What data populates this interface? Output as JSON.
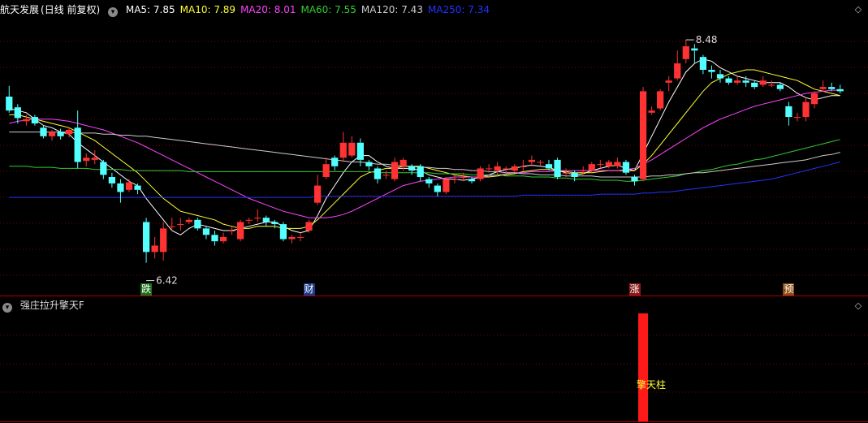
{
  "main_panel": {
    "stock_name": "航天发展",
    "period": "(日线 前复权)",
    "ma_legend": [
      {
        "label": "MA5: 7.85",
        "color": "#ffffff"
      },
      {
        "label": "MA10: 7.89",
        "color": "#ffff33"
      },
      {
        "label": "MA20: 8.01",
        "color": "#ff44ff"
      },
      {
        "label": "MA60: 7.55",
        "color": "#33cc33"
      },
      {
        "label": "MA120: 7.43",
        "color": "#cccccc"
      },
      {
        "label": "MA250: 7.34",
        "color": "#2233ff"
      }
    ],
    "high_marker": "8.48",
    "low_marker": "6.42",
    "signal_tags": [
      {
        "text": "跌",
        "bg": "#1a6e1a",
        "color": "#ffffff"
      },
      {
        "text": "财",
        "bg": "#1a3a8a",
        "color": "#ffffff"
      },
      {
        "text": "涨",
        "bg": "#8a1a1a",
        "color": "#ffffff"
      },
      {
        "text": "预",
        "bg": "#8a4a10",
        "color": "#ffffff"
      }
    ]
  },
  "sub_panel": {
    "indicator_name": "强庄拉升擎天F",
    "pillar_label": "擎天柱"
  },
  "icons": {
    "settings": "circle-down-icon",
    "maximize": "diamond-icon"
  },
  "colors": {
    "up": "#ff3333",
    "down": "#54ffff",
    "grid": "#7a0000",
    "pillar": "#ff1a1a"
  },
  "chart_data": {
    "type": "candlestick",
    "y_range": [
      6.2,
      8.7
    ],
    "candles": [
      {
        "o": 7.95,
        "c": 7.82,
        "h": 8.05,
        "l": 7.8
      },
      {
        "o": 7.85,
        "c": 7.75,
        "h": 7.88,
        "l": 7.7
      },
      {
        "o": 7.72,
        "c": 7.74,
        "h": 7.78,
        "l": 7.68
      },
      {
        "o": 7.76,
        "c": 7.7,
        "h": 7.78,
        "l": 7.68
      },
      {
        "o": 7.66,
        "c": 7.58,
        "h": 7.68,
        "l": 7.56
      },
      {
        "o": 7.58,
        "c": 7.62,
        "h": 7.64,
        "l": 7.54
      },
      {
        "o": 7.62,
        "c": 7.58,
        "h": 7.65,
        "l": 7.55
      },
      {
        "o": 7.6,
        "c": 7.64,
        "h": 7.66,
        "l": 7.57
      },
      {
        "o": 7.66,
        "c": 7.34,
        "h": 7.82,
        "l": 7.28
      },
      {
        "o": 7.35,
        "c": 7.38,
        "h": 7.42,
        "l": 7.3
      },
      {
        "o": 7.36,
        "c": 7.38,
        "h": 7.45,
        "l": 7.32
      },
      {
        "o": 7.34,
        "c": 7.22,
        "h": 7.36,
        "l": 7.18
      },
      {
        "o": 7.2,
        "c": 7.14,
        "h": 7.24,
        "l": 7.1
      },
      {
        "o": 7.14,
        "c": 7.06,
        "h": 7.18,
        "l": 6.96
      },
      {
        "o": 7.08,
        "c": 7.15,
        "h": 7.18,
        "l": 7.06
      },
      {
        "o": 7.12,
        "c": 7.08,
        "h": 7.14,
        "l": 7.04
      },
      {
        "o": 6.78,
        "c": 6.5,
        "h": 6.82,
        "l": 6.4
      },
      {
        "o": 6.5,
        "c": 6.56,
        "h": 6.64,
        "l": 6.44
      },
      {
        "o": 6.5,
        "c": 6.72,
        "h": 6.78,
        "l": 6.42
      },
      {
        "o": 6.74,
        "c": 6.74,
        "h": 6.82,
        "l": 6.7
      },
      {
        "o": 6.76,
        "c": 6.76,
        "h": 6.82,
        "l": 6.7
      },
      {
        "o": 6.78,
        "c": 6.8,
        "h": 6.82,
        "l": 6.76
      },
      {
        "o": 6.8,
        "c": 6.72,
        "h": 6.82,
        "l": 6.7
      },
      {
        "o": 6.72,
        "c": 6.66,
        "h": 6.74,
        "l": 6.62
      },
      {
        "o": 6.66,
        "c": 6.6,
        "h": 6.7,
        "l": 6.56
      },
      {
        "o": 6.6,
        "c": 6.64,
        "h": 6.68,
        "l": 6.58
      },
      {
        "o": 6.7,
        "c": 6.7,
        "h": 6.74,
        "l": 6.66
      },
      {
        "o": 6.62,
        "c": 6.78,
        "h": 6.8,
        "l": 6.6
      },
      {
        "o": 6.8,
        "c": 6.8,
        "h": 6.82,
        "l": 6.76
      },
      {
        "o": 6.82,
        "c": 6.82,
        "h": 6.9,
        "l": 6.78
      },
      {
        "o": 6.82,
        "c": 6.78,
        "h": 6.84,
        "l": 6.74
      },
      {
        "o": 6.78,
        "c": 6.76,
        "h": 6.8,
        "l": 6.72
      },
      {
        "o": 6.76,
        "c": 6.62,
        "h": 6.78,
        "l": 6.6
      },
      {
        "o": 6.62,
        "c": 6.64,
        "h": 6.66,
        "l": 6.58
      },
      {
        "o": 6.64,
        "c": 6.64,
        "h": 6.68,
        "l": 6.6
      },
      {
        "o": 6.7,
        "c": 6.78,
        "h": 6.8,
        "l": 6.68
      },
      {
        "o": 6.96,
        "c": 7.12,
        "h": 7.22,
        "l": 6.94
      },
      {
        "o": 7.2,
        "c": 7.32,
        "h": 7.38,
        "l": 7.18
      },
      {
        "o": 7.38,
        "c": 7.3,
        "h": 7.4,
        "l": 7.26
      },
      {
        "o": 7.38,
        "c": 7.52,
        "h": 7.62,
        "l": 7.34
      },
      {
        "o": 7.4,
        "c": 7.52,
        "h": 7.58,
        "l": 7.38
      },
      {
        "o": 7.52,
        "c": 7.36,
        "h": 7.56,
        "l": 7.3
      },
      {
        "o": 7.34,
        "c": 7.3,
        "h": 7.36,
        "l": 7.26
      },
      {
        "o": 7.28,
        "c": 7.18,
        "h": 7.3,
        "l": 7.14
      },
      {
        "o": 7.22,
        "c": 7.22,
        "h": 7.26,
        "l": 7.18
      },
      {
        "o": 7.18,
        "c": 7.34,
        "h": 7.38,
        "l": 7.16
      },
      {
        "o": 7.3,
        "c": 7.36,
        "h": 7.38,
        "l": 7.26
      },
      {
        "o": 7.3,
        "c": 7.26,
        "h": 7.32,
        "l": 7.22
      },
      {
        "o": 7.3,
        "c": 7.2,
        "h": 7.32,
        "l": 7.16
      },
      {
        "o": 7.18,
        "c": 7.14,
        "h": 7.2,
        "l": 7.1
      },
      {
        "o": 7.12,
        "c": 7.06,
        "h": 7.14,
        "l": 7.02
      },
      {
        "o": 7.06,
        "c": 7.18,
        "h": 7.2,
        "l": 7.04
      },
      {
        "o": 7.18,
        "c": 7.18,
        "h": 7.22,
        "l": 7.14
      },
      {
        "o": 7.2,
        "c": 7.2,
        "h": 7.24,
        "l": 7.16
      },
      {
        "o": 7.18,
        "c": 7.16,
        "h": 7.2,
        "l": 7.14
      },
      {
        "o": 7.18,
        "c": 7.28,
        "h": 7.3,
        "l": 7.16
      },
      {
        "o": 7.28,
        "c": 7.28,
        "h": 7.32,
        "l": 7.24
      },
      {
        "o": 7.26,
        "c": 7.3,
        "h": 7.34,
        "l": 7.22
      },
      {
        "o": 7.28,
        "c": 7.28,
        "h": 7.3,
        "l": 7.24
      },
      {
        "o": 7.26,
        "c": 7.3,
        "h": 7.32,
        "l": 7.24
      },
      {
        "o": 7.3,
        "c": 7.3,
        "h": 7.36,
        "l": 7.26
      },
      {
        "o": 7.34,
        "c": 7.36,
        "h": 7.4,
        "l": 7.3
      },
      {
        "o": 7.34,
        "c": 7.34,
        "h": 7.36,
        "l": 7.3
      },
      {
        "o": 7.32,
        "c": 7.28,
        "h": 7.36,
        "l": 7.26
      },
      {
        "o": 7.36,
        "c": 7.2,
        "h": 7.38,
        "l": 7.18
      },
      {
        "o": 7.24,
        "c": 7.24,
        "h": 7.28,
        "l": 7.2
      },
      {
        "o": 7.24,
        "c": 7.2,
        "h": 7.26,
        "l": 7.16
      },
      {
        "o": 7.26,
        "c": 7.26,
        "h": 7.3,
        "l": 7.22
      },
      {
        "o": 7.26,
        "c": 7.32,
        "h": 7.34,
        "l": 7.24
      },
      {
        "o": 7.32,
        "c": 7.32,
        "h": 7.36,
        "l": 7.28
      },
      {
        "o": 7.3,
        "c": 7.34,
        "h": 7.36,
        "l": 7.28
      },
      {
        "o": 7.3,
        "c": 7.34,
        "h": 7.38,
        "l": 7.28
      },
      {
        "o": 7.34,
        "c": 7.24,
        "h": 7.36,
        "l": 7.22
      },
      {
        "o": 7.2,
        "c": 7.16,
        "h": 7.22,
        "l": 7.12
      },
      {
        "o": 7.18,
        "c": 8.0,
        "h": 8.04,
        "l": 7.16
      },
      {
        "o": 7.8,
        "c": 7.82,
        "h": 7.86,
        "l": 7.78
      },
      {
        "o": 7.84,
        "c": 8.0,
        "h": 8.02,
        "l": 7.82
      },
      {
        "o": 8.08,
        "c": 8.1,
        "h": 8.14,
        "l": 8.0
      },
      {
        "o": 8.12,
        "c": 8.26,
        "h": 8.38,
        "l": 8.1
      },
      {
        "o": 8.3,
        "c": 8.42,
        "h": 8.48,
        "l": 8.26
      },
      {
        "o": 8.4,
        "c": 8.38,
        "h": 8.44,
        "l": 8.26
      },
      {
        "o": 8.32,
        "c": 8.2,
        "h": 8.34,
        "l": 8.16
      },
      {
        "o": 8.2,
        "c": 8.18,
        "h": 8.24,
        "l": 8.12
      },
      {
        "o": 8.16,
        "c": 8.12,
        "h": 8.2,
        "l": 8.08
      },
      {
        "o": 8.12,
        "c": 8.08,
        "h": 8.14,
        "l": 8.06
      },
      {
        "o": 8.08,
        "c": 8.1,
        "h": 8.14,
        "l": 8.06
      },
      {
        "o": 8.1,
        "c": 8.08,
        "h": 8.14,
        "l": 8.04
      },
      {
        "o": 8.08,
        "c": 8.04,
        "h": 8.1,
        "l": 8.02
      },
      {
        "o": 8.06,
        "c": 8.1,
        "h": 8.14,
        "l": 8.04
      },
      {
        "o": 8.06,
        "c": 8.06,
        "h": 8.1,
        "l": 8.04
      },
      {
        "o": 8.06,
        "c": 8.02,
        "h": 8.08,
        "l": 8.0
      },
      {
        "o": 7.86,
        "c": 7.76,
        "h": 7.9,
        "l": 7.68
      },
      {
        "o": 7.76,
        "c": 7.76,
        "h": 7.8,
        "l": 7.72
      },
      {
        "o": 7.76,
        "c": 7.9,
        "h": 7.94,
        "l": 7.72
      },
      {
        "o": 7.88,
        "c": 7.98,
        "h": 8.0,
        "l": 7.84
      },
      {
        "o": 8.02,
        "c": 8.04,
        "h": 8.1,
        "l": 8.0
      },
      {
        "o": 8.04,
        "c": 8.02,
        "h": 8.08,
        "l": 8.0
      },
      {
        "o": 8.02,
        "c": 8.0,
        "h": 8.06,
        "l": 7.98
      }
    ],
    "ma_lines": {
      "MA5": [
        7.84,
        7.82,
        7.8,
        7.74,
        7.68,
        7.66,
        7.62,
        7.6,
        7.52,
        7.46,
        7.4,
        7.34,
        7.28,
        7.22,
        7.16,
        7.12,
        7.0,
        6.9,
        6.8,
        6.7,
        6.66,
        6.72,
        6.76,
        6.74,
        6.72,
        6.7,
        6.7,
        6.72,
        6.74,
        6.76,
        6.78,
        6.78,
        6.74,
        6.7,
        6.68,
        6.7,
        6.84,
        7.0,
        7.12,
        7.24,
        7.34,
        7.4,
        7.4,
        7.34,
        7.3,
        7.28,
        7.28,
        7.28,
        7.26,
        7.22,
        7.2,
        7.18,
        7.18,
        7.17,
        7.18,
        7.2,
        7.22,
        7.25,
        7.27,
        7.28,
        7.3,
        7.31,
        7.3,
        7.29,
        7.26,
        7.24,
        7.22,
        7.23,
        7.26,
        7.28,
        7.3,
        7.31,
        7.28,
        7.26,
        7.42,
        7.58,
        7.74,
        7.9,
        8.04,
        8.18,
        8.26,
        8.3,
        8.28,
        8.22,
        8.18,
        8.14,
        8.12,
        8.1,
        8.08,
        8.08,
        8.08,
        8.04,
        7.98,
        7.94,
        7.92,
        7.94,
        7.96,
        7.96
      ],
      "MA10": [
        7.78,
        7.78,
        7.76,
        7.74,
        7.72,
        7.7,
        7.68,
        7.66,
        7.62,
        7.58,
        7.54,
        7.48,
        7.42,
        7.36,
        7.3,
        7.24,
        7.16,
        7.08,
        7.0,
        6.94,
        6.88,
        6.86,
        6.84,
        6.82,
        6.8,
        6.76,
        6.74,
        6.72,
        6.72,
        6.74,
        6.74,
        6.74,
        6.72,
        6.72,
        6.72,
        6.74,
        6.8,
        6.88,
        6.96,
        7.04,
        7.12,
        7.2,
        7.24,
        7.26,
        7.28,
        7.28,
        7.3,
        7.3,
        7.3,
        7.28,
        7.26,
        7.24,
        7.22,
        7.21,
        7.2,
        7.2,
        7.2,
        7.21,
        7.22,
        7.23,
        7.25,
        7.26,
        7.27,
        7.27,
        7.26,
        7.25,
        7.24,
        7.24,
        7.24,
        7.25,
        7.26,
        7.26,
        7.26,
        7.26,
        7.32,
        7.4,
        7.5,
        7.6,
        7.7,
        7.8,
        7.9,
        8.0,
        8.08,
        8.12,
        8.16,
        8.18,
        8.2,
        8.2,
        8.18,
        8.16,
        8.14,
        8.12,
        8.1,
        8.06,
        8.02,
        8.0,
        7.98,
        7.96
      ],
      "MA20": [
        7.7,
        7.72,
        7.73,
        7.74,
        7.74,
        7.74,
        7.73,
        7.72,
        7.7,
        7.68,
        7.66,
        7.64,
        7.61,
        7.58,
        7.55,
        7.52,
        7.48,
        7.44,
        7.4,
        7.36,
        7.32,
        7.28,
        7.24,
        7.2,
        7.16,
        7.12,
        7.08,
        7.04,
        7.0,
        6.97,
        6.94,
        6.91,
        6.88,
        6.86,
        6.84,
        6.82,
        6.82,
        6.82,
        6.83,
        6.85,
        6.88,
        6.92,
        6.96,
        7.0,
        7.04,
        7.08,
        7.12,
        7.14,
        7.16,
        7.17,
        7.18,
        7.19,
        7.2,
        7.2,
        7.2,
        7.2,
        7.21,
        7.22,
        7.23,
        7.24,
        7.24,
        7.25,
        7.25,
        7.25,
        7.26,
        7.26,
        7.26,
        7.26,
        7.26,
        7.26,
        7.26,
        7.26,
        7.27,
        7.28,
        7.32,
        7.36,
        7.41,
        7.46,
        7.51,
        7.56,
        7.61,
        7.66,
        7.7,
        7.74,
        7.77,
        7.8,
        7.83,
        7.86,
        7.88,
        7.9,
        7.92,
        7.94,
        7.96,
        7.98,
        7.99,
        8.0,
        8.01,
        8.01
      ],
      "MA60": [
        7.3,
        7.3,
        7.3,
        7.29,
        7.29,
        7.29,
        7.28,
        7.28,
        7.28,
        7.28,
        7.27,
        7.27,
        7.27,
        7.27,
        7.26,
        7.26,
        7.26,
        7.26,
        7.26,
        7.26,
        7.26,
        7.25,
        7.25,
        7.25,
        7.25,
        7.25,
        7.25,
        7.25,
        7.25,
        7.25,
        7.25,
        7.25,
        7.25,
        7.25,
        7.25,
        7.25,
        7.25,
        7.25,
        7.25,
        7.25,
        7.25,
        7.25,
        7.25,
        7.24,
        7.24,
        7.24,
        7.24,
        7.24,
        7.24,
        7.24,
        7.23,
        7.23,
        7.23,
        7.23,
        7.22,
        7.22,
        7.22,
        7.22,
        7.21,
        7.21,
        7.21,
        7.2,
        7.2,
        7.2,
        7.19,
        7.19,
        7.18,
        7.18,
        7.18,
        7.17,
        7.17,
        7.17,
        7.16,
        7.16,
        7.17,
        7.18,
        7.19,
        7.2,
        7.21,
        7.23,
        7.24,
        7.26,
        7.27,
        7.29,
        7.31,
        7.32,
        7.34,
        7.36,
        7.37,
        7.39,
        7.41,
        7.43,
        7.45,
        7.47,
        7.49,
        7.51,
        7.53,
        7.55
      ],
      "MA120": [
        7.62,
        7.62,
        7.62,
        7.62,
        7.62,
        7.62,
        7.62,
        7.62,
        7.61,
        7.61,
        7.61,
        7.6,
        7.6,
        7.59,
        7.59,
        7.58,
        7.58,
        7.57,
        7.56,
        7.55,
        7.54,
        7.53,
        7.52,
        7.51,
        7.5,
        7.49,
        7.48,
        7.47,
        7.46,
        7.45,
        7.44,
        7.43,
        7.42,
        7.41,
        7.4,
        7.39,
        7.38,
        7.37,
        7.36,
        7.35,
        7.34,
        7.34,
        7.33,
        7.32,
        7.32,
        7.31,
        7.3,
        7.3,
        7.29,
        7.29,
        7.28,
        7.28,
        7.27,
        7.27,
        7.26,
        7.26,
        7.25,
        7.25,
        7.24,
        7.24,
        7.23,
        7.23,
        7.22,
        7.22,
        7.22,
        7.21,
        7.21,
        7.21,
        7.21,
        7.2,
        7.2,
        7.2,
        7.2,
        7.2,
        7.2,
        7.21,
        7.21,
        7.22,
        7.22,
        7.23,
        7.24,
        7.24,
        7.25,
        7.26,
        7.27,
        7.28,
        7.29,
        7.3,
        7.31,
        7.32,
        7.33,
        7.34,
        7.35,
        7.36,
        7.38,
        7.4,
        7.41,
        7.43
      ],
      "MA250": [
        7.01,
        7.01,
        7.01,
        7.01,
        7.01,
        7.01,
        7.01,
        7.01,
        7.01,
        7.01,
        7.01,
        7.01,
        7.01,
        7.01,
        7.01,
        7.01,
        7.01,
        7.01,
        7.01,
        7.01,
        7.01,
        7.01,
        7.01,
        7.01,
        7.01,
        7.01,
        7.01,
        7.01,
        7.01,
        7.01,
        7.01,
        7.01,
        7.01,
        7.01,
        7.01,
        7.01,
        7.02,
        7.02,
        7.02,
        7.02,
        7.02,
        7.02,
        7.02,
        7.02,
        7.02,
        7.02,
        7.02,
        7.02,
        7.02,
        7.02,
        7.02,
        7.02,
        7.02,
        7.02,
        7.02,
        7.02,
        7.02,
        7.02,
        7.02,
        7.02,
        7.03,
        7.03,
        7.03,
        7.03,
        7.03,
        7.03,
        7.03,
        7.03,
        7.03,
        7.04,
        7.04,
        7.04,
        7.04,
        7.04,
        7.05,
        7.05,
        7.06,
        7.06,
        7.07,
        7.08,
        7.09,
        7.1,
        7.11,
        7.12,
        7.13,
        7.14,
        7.15,
        7.16,
        7.17,
        7.18,
        7.2,
        7.22,
        7.24,
        7.26,
        7.28,
        7.3,
        7.32,
        7.34
      ]
    }
  }
}
